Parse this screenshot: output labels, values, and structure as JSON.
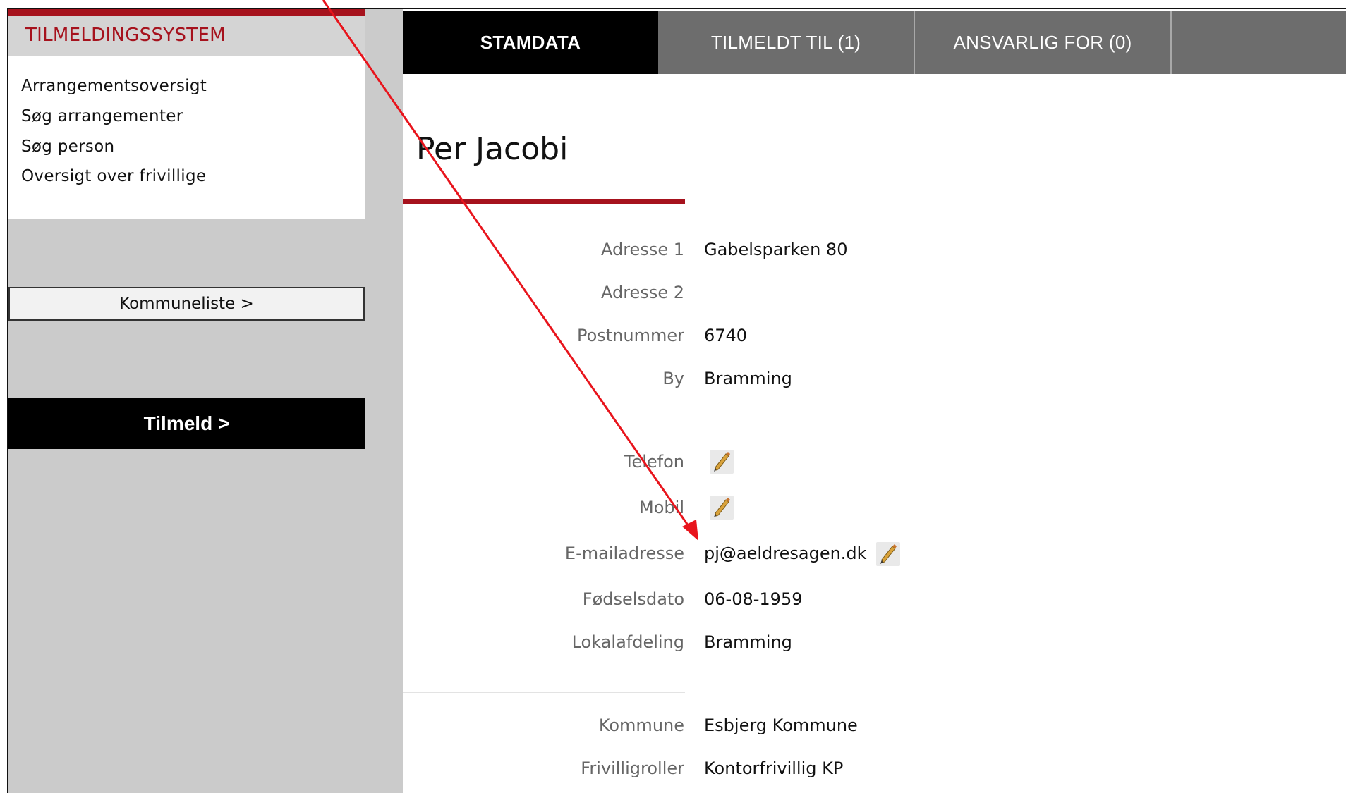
{
  "sidebar": {
    "title": "TILMELDINGSSYSTEM",
    "menu": [
      "Arrangementsoversigt",
      "Søg arrangementer",
      "Søg person",
      "Oversigt over frivillige"
    ],
    "kommune_button": "Kommuneliste >",
    "tilmeld_button": "Tilmeld >"
  },
  "tabs": [
    "STAMDATA",
    "TILMELDT TIL (1)",
    "ANSVARLIG FOR (0)"
  ],
  "person": {
    "name": "Per Jacobi"
  },
  "address_fields": {
    "adresse1": {
      "label": "Adresse 1",
      "value": "Gabelsparken 80"
    },
    "adresse2": {
      "label": "Adresse 2",
      "value": ""
    },
    "postnummer": {
      "label": "Postnummer",
      "value": "6740"
    },
    "by": {
      "label": "By",
      "value": "Bramming"
    }
  },
  "contact_fields": {
    "telefon": {
      "label": "Telefon",
      "value": ""
    },
    "mobil": {
      "label": "Mobil",
      "value": ""
    },
    "email": {
      "label": "E-mailadresse",
      "value": "pj@aeldresagen.dk"
    },
    "foedselsdato": {
      "label": "Fødselsdato",
      "value": "06-08-1959"
    },
    "lokalafdeling": {
      "label": "Lokalafdeling",
      "value": "Bramming"
    }
  },
  "other_fields": {
    "kommune": {
      "label": "Kommune",
      "value": "Esbjerg Kommune"
    },
    "frivilligroller": {
      "label": "Frivilligroller",
      "value": "Kontorfrivillig KP"
    }
  },
  "icons": {
    "edit": "pencil-icon"
  },
  "colors": {
    "accent": "#a6121d",
    "sidebar_bg": "#cbcbcb",
    "tab_bg": "#6d6d6d",
    "tab_active_bg": "#000000",
    "annotation_arrow": "#e8141c"
  }
}
